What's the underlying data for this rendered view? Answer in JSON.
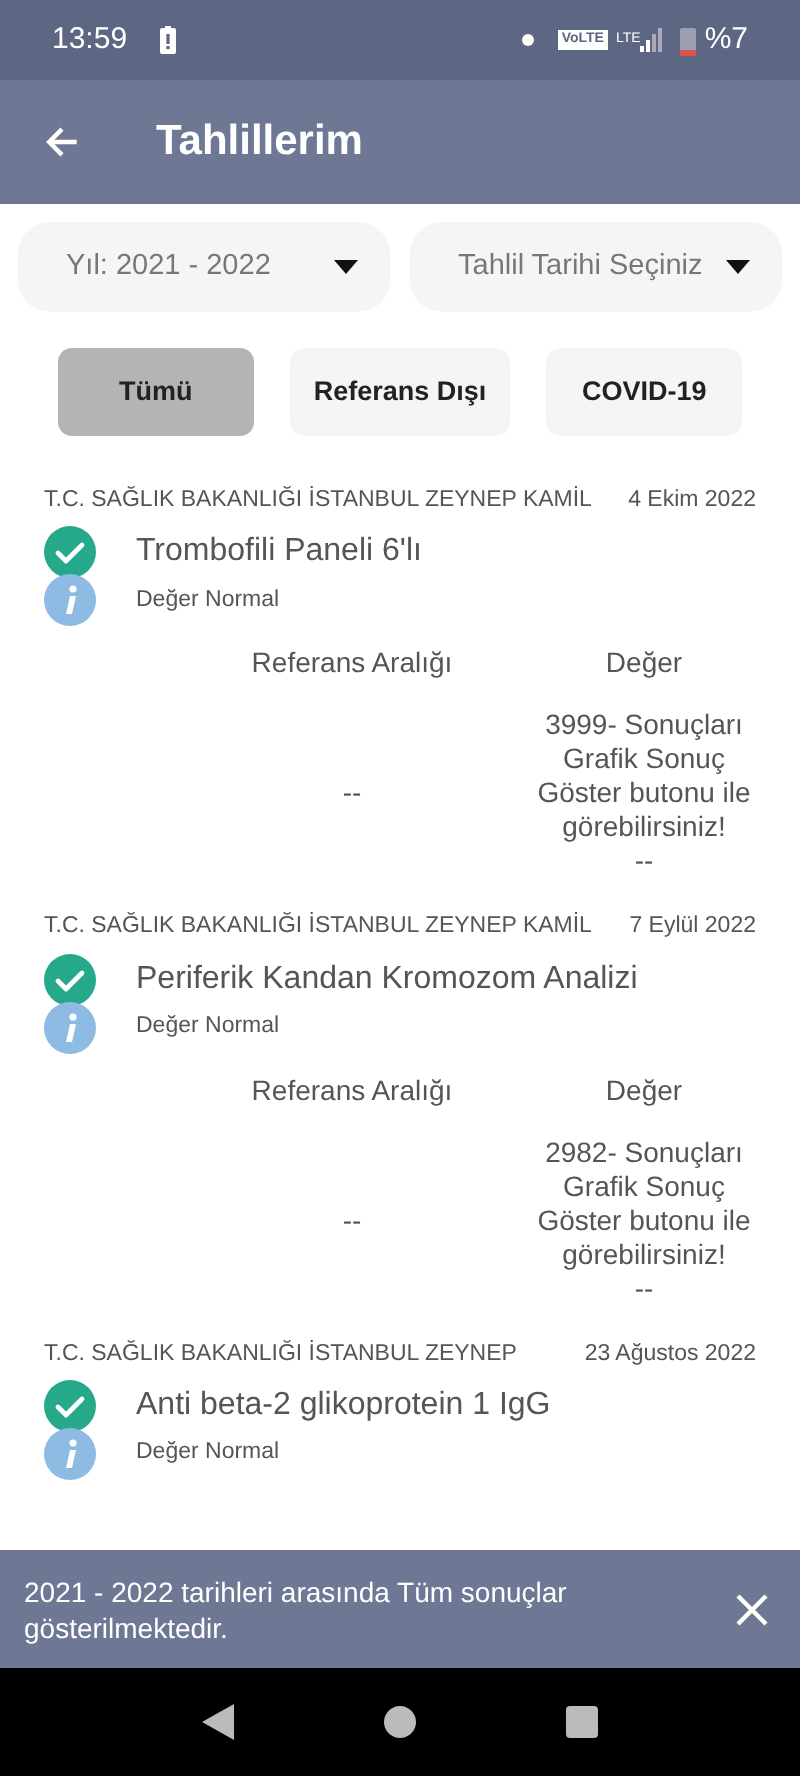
{
  "status_bar": {
    "time": "13:59",
    "volte": "VoLTE",
    "network": "LTE",
    "battery": "%7"
  },
  "app_bar": {
    "title": "Tahlillerim"
  },
  "dropdowns": [
    {
      "label": "Yıl: 2021 - 2022"
    },
    {
      "label": "Tahlil Tarihi Seçiniz"
    }
  ],
  "filters": [
    {
      "label": "Tümü",
      "selected": true
    },
    {
      "label": "Referans Dışı",
      "selected": false
    },
    {
      "label": "COVID-19",
      "selected": false
    }
  ],
  "results": [
    {
      "institution": "T.C. SAĞLIK BAKANLIĞI İSTANBUL ZEYNEP KAMİL",
      "date": "4 Ekim 2022",
      "title": "Trombofili Paneli 6'lı",
      "status": "Değer Normal",
      "table": {
        "reference_header": "Referans Aralığı",
        "value_header": "Değer",
        "reference": "--",
        "value": "3999- Sonuçları Grafik Sonuç Göster butonu ile görebilirsiniz!",
        "value_note": "--"
      }
    },
    {
      "institution": "T.C. SAĞLIK BAKANLIĞI İSTANBUL ZEYNEP KAMİL",
      "date": "7 Eylül 2022",
      "title": "Periferik Kandan Kromozom Analizi",
      "status": "Değer Normal",
      "table": {
        "reference_header": "Referans Aralığı",
        "value_header": "Değer",
        "reference": "--",
        "value": "2982- Sonuçları Grafik Sonuç Göster butonu ile görebilirsiniz!",
        "value_note": "--"
      }
    },
    {
      "institution": "T.C. SAĞLIK BAKANLIĞI İSTANBUL ZEYNEP",
      "date": "23 Ağustos 2022",
      "title": "Anti beta-2 glikoprotein 1 IgG",
      "status": "Değer Normal"
    }
  ],
  "snackbar": {
    "message": "2021 - 2022 tarihleri arasında Tüm sonuçlar gösterilmektedir."
  }
}
